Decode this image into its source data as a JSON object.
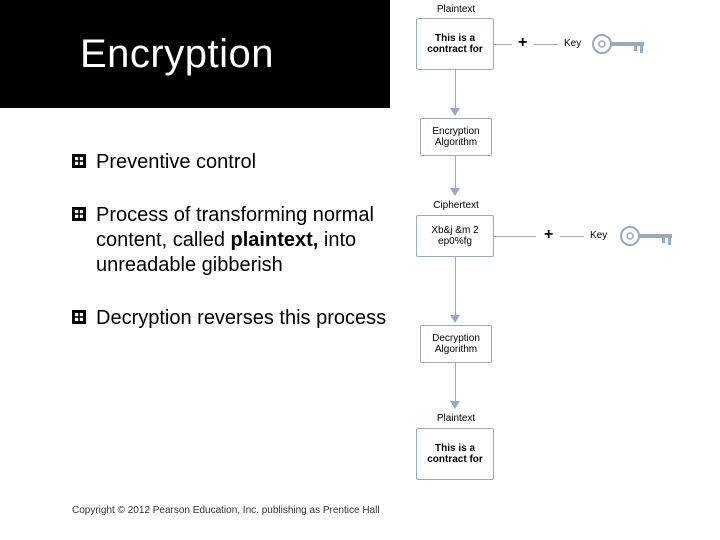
{
  "title": "Encryption",
  "bullets": [
    {
      "text": "Preventive control"
    },
    {
      "pre": "Process of transforming normal content, called ",
      "bold": "plaintext,",
      "post": " into unreadable gibberish"
    },
    {
      "text": "Decryption reverses this process"
    }
  ],
  "footer": "Copyright © 2012 Pearson Education, Inc. publishing as Prentice Hall",
  "diagram": {
    "plaintext_top_label": "Plaintext",
    "plaintext_top_text": "This is a contract for",
    "key_top_label": "Key",
    "plus": "+",
    "encryption_label": "Encryption Algorithm",
    "ciphertext_label": "Ciphertext",
    "ciphertext_text": "Xb&j &m 2 ep0%fg",
    "key_bottom_label": "Key",
    "decryption_label": "Decryption Algorithm",
    "plaintext_bottom_label": "Plaintext",
    "plaintext_bottom_text": "This is a contract for"
  }
}
